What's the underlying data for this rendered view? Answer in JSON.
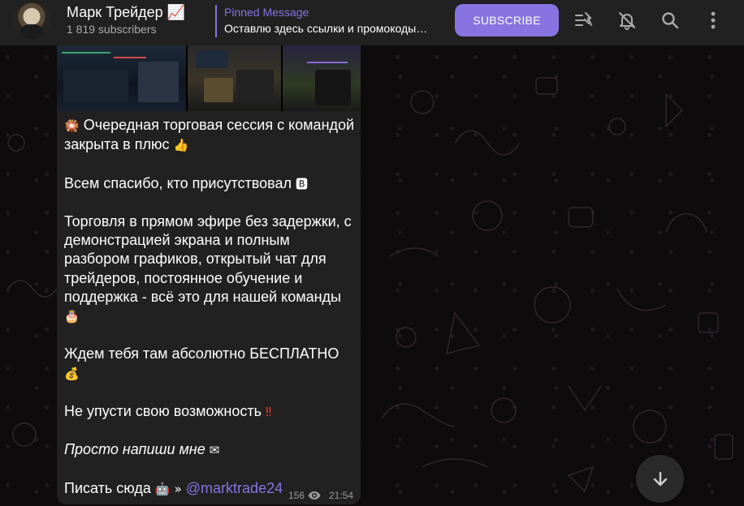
{
  "header": {
    "title": "Марк Трейдер 📈",
    "subscribers": "1 819 subscribers",
    "pinned_label": "Pinned Message",
    "pinned_text": "Оставлю здесь ссылки и промокоды…",
    "subscribe_label": "SUBSCRIBE",
    "icons": [
      "voice-chat-icon",
      "mute-bell-icon",
      "search-icon",
      "more-vert-icon"
    ]
  },
  "message": {
    "line1": "Очередная торговая сессия с командой закрыта в плюс",
    "line2": "Всем спасибо, кто присутствовал",
    "line3": "Торговля в прямом эфире без задержки, с демонстрацией экрана и полным разбором графиков, открытый чат для трейдеров, постоянное обучение и поддержка - всё это для нашей команды",
    "line4": "Ждем тебя там абсолютно БЕСПЛАТНО",
    "line5": "Не упусти свою возможность",
    "line6": "Просто напиши мне",
    "line7": "Писать сюда",
    "mention": "@marktrade24",
    "views": "156",
    "time": "21:54"
  },
  "colors": {
    "accent": "#8774e1",
    "header_bg": "#212121",
    "bubble_bg": "#212121"
  }
}
